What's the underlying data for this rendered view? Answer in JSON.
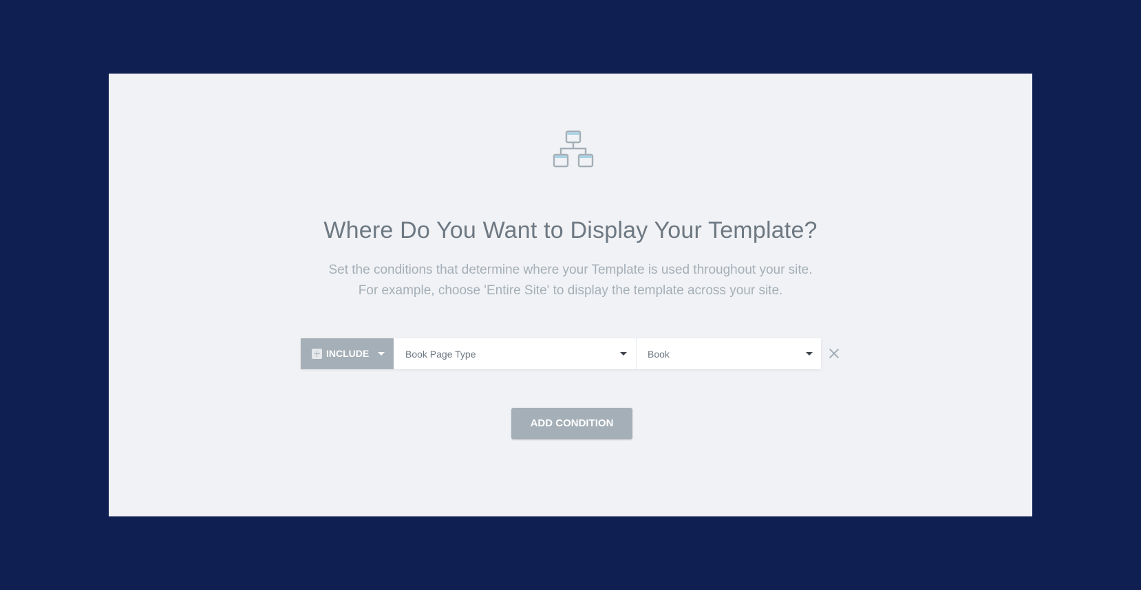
{
  "dialog": {
    "icon": "site-hierarchy-icon",
    "title": "Where Do You Want to Display Your Template?",
    "description_line1": "Set the conditions that determine where your Template is used throughout your site.",
    "description_line2": "For example, choose 'Entire Site' to display the template across your site."
  },
  "condition": {
    "include_label": "INCLUDE",
    "type_value": "Book Page Type",
    "sub_value": "Book",
    "remove_icon": "close-icon"
  },
  "actions": {
    "add_label": "ADD CONDITION"
  },
  "colors": {
    "background": "#0f1f52",
    "panel": "#f1f2f5",
    "gray_button": "#a4afb7",
    "title_text": "#6d7882",
    "subtitle_text": "#a4afb7",
    "icon_accent": "#a8d3e6"
  }
}
